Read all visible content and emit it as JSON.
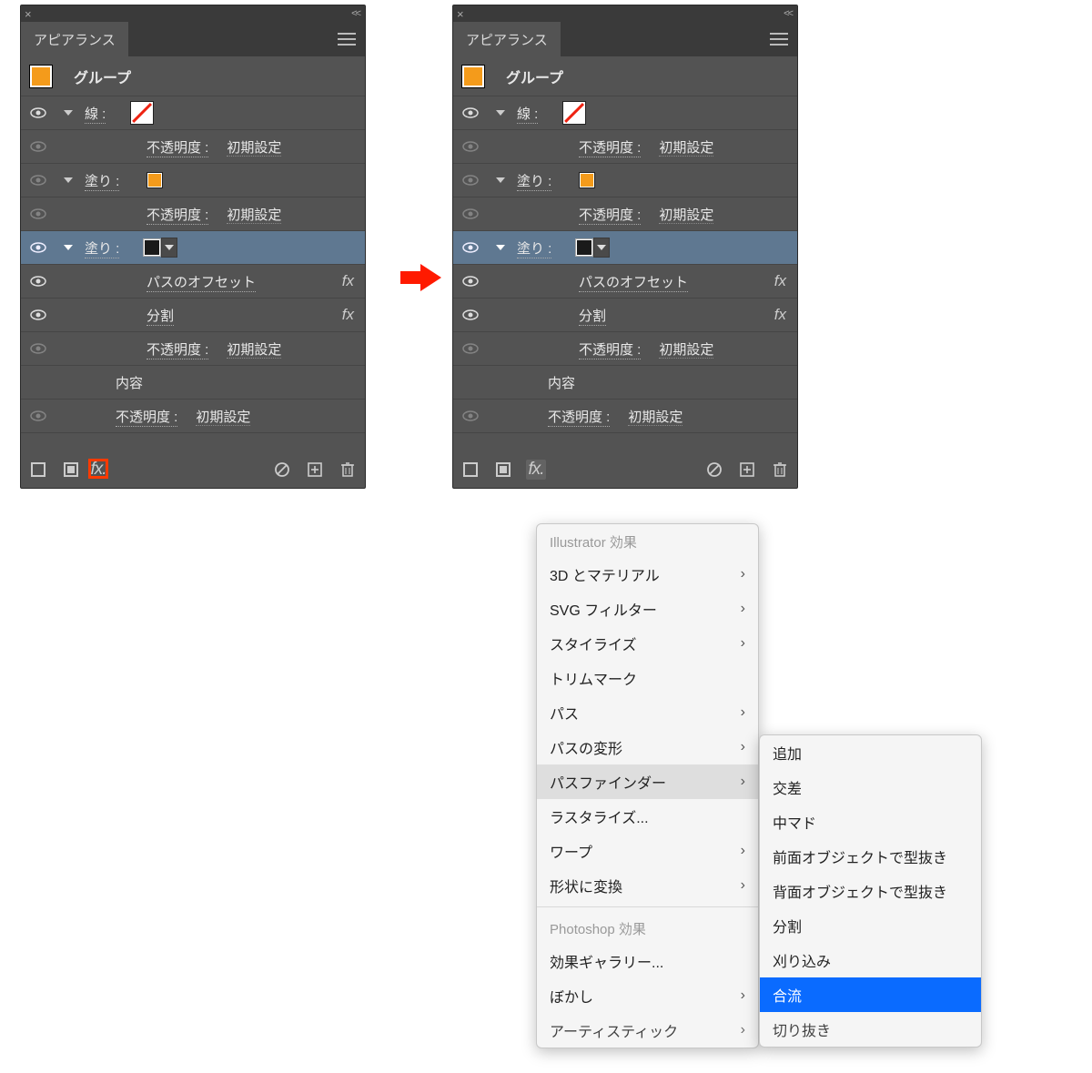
{
  "panel": {
    "tab": "アピアランス",
    "group_title": "グループ",
    "stroke_label": "線 :",
    "opacity_label": "不透明度 :",
    "opacity_value": "初期設定",
    "fill_label": "塗り :",
    "offset_path": "パスのオフセット",
    "divide": "分割",
    "contents": "内容",
    "fx": "fx"
  },
  "footer": {
    "fx": "fx."
  },
  "menu": {
    "header1": "Illustrator 効果",
    "items1": [
      "3D とマテリアル",
      "SVG フィルター",
      "スタイライズ",
      "トリムマーク",
      "パス",
      "パスの変形",
      "パスファインダー",
      "ラスタライズ...",
      "ワープ",
      "形状に変換"
    ],
    "header2": "Photoshop 効果",
    "items2": [
      "効果ギャラリー...",
      "ぼかし",
      "アーティスティック"
    ],
    "submenu": [
      "追加",
      "交差",
      "中マド",
      "前面オブジェクトで型抜き",
      "背面オブジェクトで型抜き",
      "分割",
      "刈り込み",
      "合流",
      "切り抜き"
    ],
    "arrows1": [
      true,
      true,
      true,
      false,
      true,
      true,
      true,
      false,
      true,
      true
    ],
    "arrows2": [
      false,
      true,
      true
    ]
  }
}
